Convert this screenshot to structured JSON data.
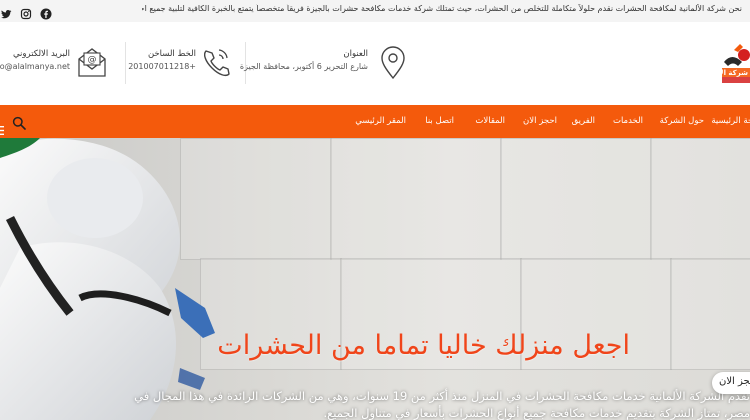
{
  "topbar": {
    "announcement": "نحن شركة الألمانية لمكافحة الحشرات نقدم حلولاً متكاملة للتخلص من الحشرات، حيث تمتلك شركة خدمات مكافحة حشرات بالجيزة فريقاً متخصصاً يتمتع بالخبرة الكافية لتلبية جميع احتياجات منزلكم.",
    "social_icons": [
      "twitter-icon",
      "instagram-icon",
      "facebook-icon"
    ]
  },
  "header": {
    "email_label": "البريد الالكتروني",
    "email_value": "info@alalmanya.net",
    "hotline_label": "الخط الساخن",
    "hotline_value": "+201007011218",
    "address_label": "العنوان",
    "address_value": "شارع التحرير 6 أكتوبر، محافظة الجيزة",
    "logo_text": "شركة الألمانية"
  },
  "nav": {
    "items": [
      "الصفحة الرئيسية",
      "حول الشركة",
      "الخدمات",
      "الفريق",
      "احجز الان",
      "المقالات",
      "اتصل بنا",
      "المقر الرئيسي"
    ]
  },
  "hero": {
    "headline": "اجعل منزلك خاليا تماما من الحشرات",
    "paragraph": "تقدم الشركة الألمانية خدمات مكافحة الحشرات في المنزل منذ أكثر من 19 سنوات، وهي من الشركات الرائدة في هذا المجال في مصر، تمتاز الشركة بتقديم خدمات مكافحة جميع أنواع الحشرات بأسعار في متناول الجميع.",
    "cta_label": "احجز الان"
  },
  "colors": {
    "accent": "#f45a0c",
    "headline": "#f0451a"
  }
}
